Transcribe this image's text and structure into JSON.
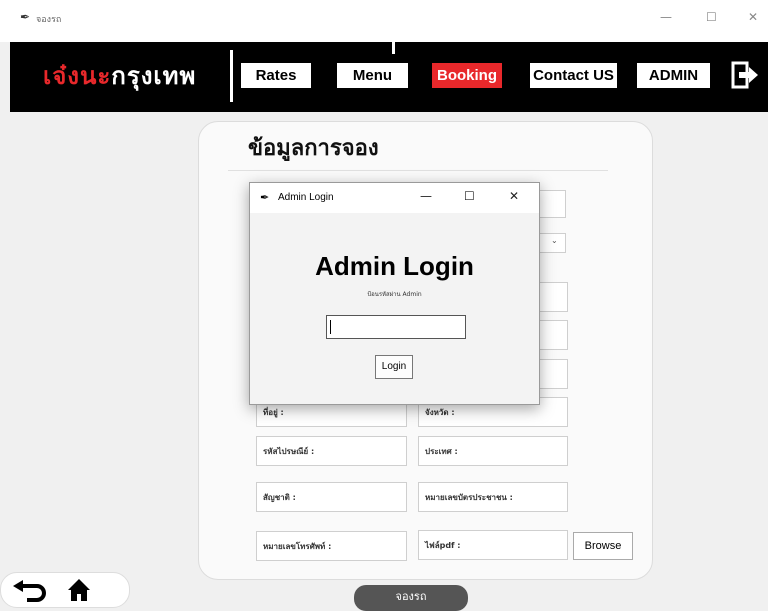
{
  "window": {
    "title": "จองรถ",
    "minimize_glyph": "—",
    "maximize_glyph": "☐",
    "close_glyph": "✕"
  },
  "navbar": {
    "logo_red": "เจ๋งนะ",
    "logo_white": "กรุงเทพ",
    "rates_label": "Rates",
    "menu_label": "Menu",
    "booking_label": "Booking",
    "contact_label": "Contact US",
    "admin_label": "ADMIN",
    "active_color": "#e8282b"
  },
  "form": {
    "title": "ข้อมูลการจอง",
    "fields": {
      "address": "ที่อยู่ :",
      "province": "จังหวัด :",
      "postal_code": "รหัสไปรษณีย์ :",
      "country": "ประเทศ :",
      "nationality": "สัญชาติ :",
      "id_card": "หมายเลขบัตรประชาชน :",
      "phone": "หมายเลขโทรศัพท์ :",
      "file_pdf": "ไฟล์pdf :"
    },
    "browse_label": "Browse",
    "submit_label": "จองรถ"
  },
  "dialog": {
    "window_title": "Admin Login",
    "heading": "Admin Login",
    "subtitle": "ป้อนรหัสผ่าน Admin",
    "password_value": "",
    "login_label": "Login"
  },
  "icons": {
    "app": "feather-icon",
    "exit": "exit-door-icon",
    "back": "back-arrow-icon",
    "home": "home-icon"
  }
}
